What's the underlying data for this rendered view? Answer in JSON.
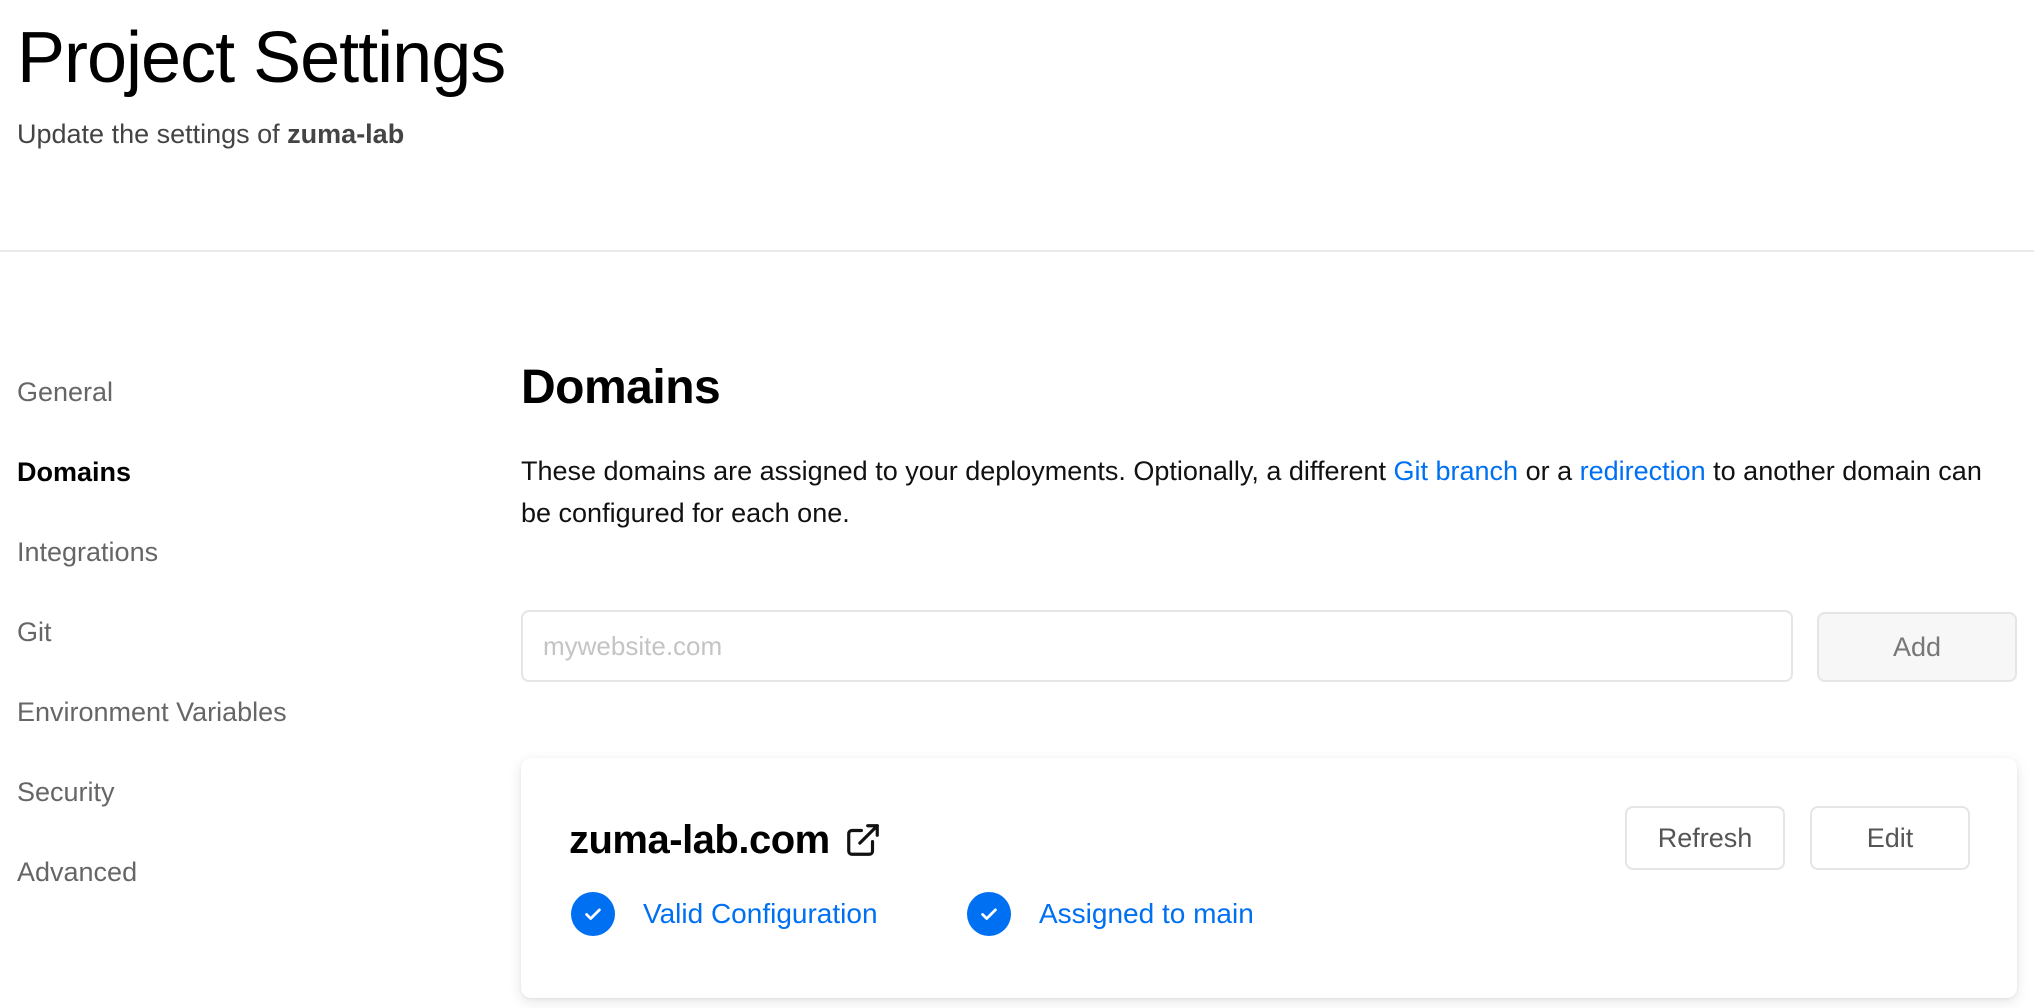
{
  "header": {
    "title": "Project Settings",
    "subtitle_prefix": "Update the settings of ",
    "project_name": "zuma-lab"
  },
  "sidebar": {
    "items": [
      {
        "label": "General",
        "active": false
      },
      {
        "label": "Domains",
        "active": true
      },
      {
        "label": "Integrations",
        "active": false
      },
      {
        "label": "Git",
        "active": false
      },
      {
        "label": "Environment Variables",
        "active": false
      },
      {
        "label": "Security",
        "active": false
      },
      {
        "label": "Advanced",
        "active": false
      }
    ]
  },
  "main": {
    "section_title": "Domains",
    "description": {
      "part1": "These domains are assigned to your deployments. Optionally, a different ",
      "link1": "Git branch",
      "part2": " or a ",
      "link2": "redirection",
      "part3": " to another domain can be configured for each one."
    },
    "input": {
      "placeholder": "mywebsite.com",
      "value": ""
    },
    "add_button": "Add",
    "domain_card": {
      "name": "zuma-lab.com",
      "refresh_button": "Refresh",
      "edit_button": "Edit",
      "status_1": "Valid Configuration",
      "status_2": "Assigned to main"
    }
  },
  "colors": {
    "accent": "#0070f3",
    "muted_text": "#666666",
    "border": "#e5e5e5"
  },
  "icons": {
    "external_link": "external-link-icon",
    "check": "check-circle-icon"
  }
}
